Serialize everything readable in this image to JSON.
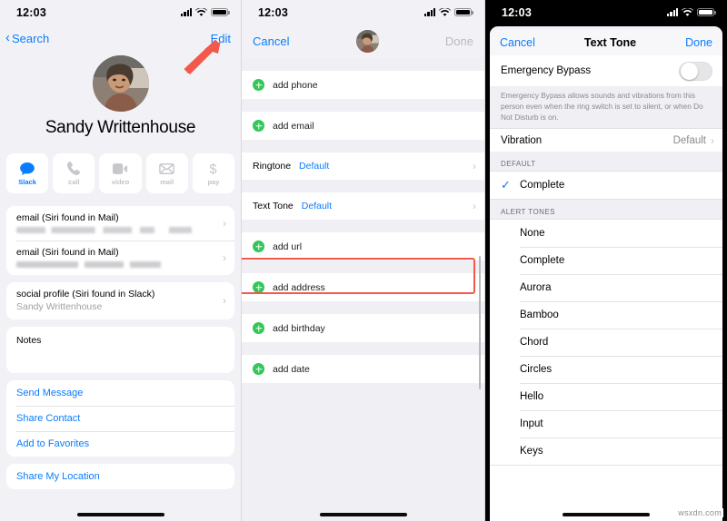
{
  "panels": {
    "contact": {
      "status": {
        "time": "12:03",
        "signal_icon": "cellular-bars-icon",
        "wifi_icon": "wifi-icon",
        "battery_icon": "battery-icon"
      },
      "nav": {
        "back_label": "Search",
        "edit_label": "Edit"
      },
      "contact_name": "Sandy Writtenhouse",
      "avatar_name": "contact-avatar",
      "actions": [
        {
          "label": "Slack",
          "icon": "message-bubble-icon",
          "active": true
        },
        {
          "label": "call",
          "icon": "phone-icon",
          "active": false
        },
        {
          "label": "video",
          "icon": "video-camera-icon",
          "active": false
        },
        {
          "label": "mail",
          "icon": "envelope-icon",
          "active": false
        },
        {
          "label": "pay",
          "icon": "dollar-sign-icon",
          "active": false
        }
      ],
      "fields": [
        {
          "label": "email (Siri found in Mail)",
          "value_redacted": true
        },
        {
          "label": "email (Siri found in Mail)",
          "value_redacted": true
        }
      ],
      "social": {
        "label": "social profile (Siri found in Slack)",
        "value": "Sandy Writtenhouse"
      },
      "notes_label": "Notes",
      "links": [
        "Send Message",
        "Share Contact",
        "Add to Favorites"
      ],
      "links2": [
        "Share My Location"
      ]
    },
    "edit": {
      "status": {
        "time": "12:03"
      },
      "nav": {
        "cancel_label": "Cancel",
        "done_label": "Done"
      },
      "add_rows_top": [
        "add phone",
        "add email"
      ],
      "ringtone": {
        "label": "Ringtone",
        "value": "Default"
      },
      "texttone": {
        "label": "Text Tone",
        "value": "Default"
      },
      "add_rows_bottom": [
        "add url",
        "add address",
        "add birthday",
        "add date"
      ],
      "highlight_color": "#f2584b"
    },
    "texttone": {
      "status": {
        "time": "12:03"
      },
      "nav": {
        "cancel_label": "Cancel",
        "title": "Text Tone",
        "done_label": "Done"
      },
      "emergency_bypass": {
        "label": "Emergency Bypass",
        "enabled": false
      },
      "footnote": "Emergency Bypass allows sounds and vibrations from this person even when the ring switch is set to silent, or when Do Not Disturb is on.",
      "vibration": {
        "label": "Vibration",
        "value": "Default"
      },
      "section_default": {
        "header": "DEFAULT",
        "items": [
          {
            "label": "Complete",
            "selected": true
          }
        ]
      },
      "section_alert": {
        "header": "ALERT TONES",
        "items": [
          {
            "label": "None",
            "selected": false
          },
          {
            "label": "Complete",
            "selected": false
          },
          {
            "label": "Aurora",
            "selected": false
          },
          {
            "label": "Bamboo",
            "selected": false
          },
          {
            "label": "Chord",
            "selected": false
          },
          {
            "label": "Circles",
            "selected": false
          },
          {
            "label": "Hello",
            "selected": false
          },
          {
            "label": "Input",
            "selected": false
          },
          {
            "label": "Keys",
            "selected": false
          }
        ]
      }
    }
  },
  "annotation": {
    "arrow_color": "#f2584b",
    "points_to": "Edit"
  },
  "watermark": "wsxdn.com",
  "colors": {
    "accent_blue": "#0a7cff",
    "green_add": "#33c759",
    "annotation_red": "#f2584b"
  }
}
